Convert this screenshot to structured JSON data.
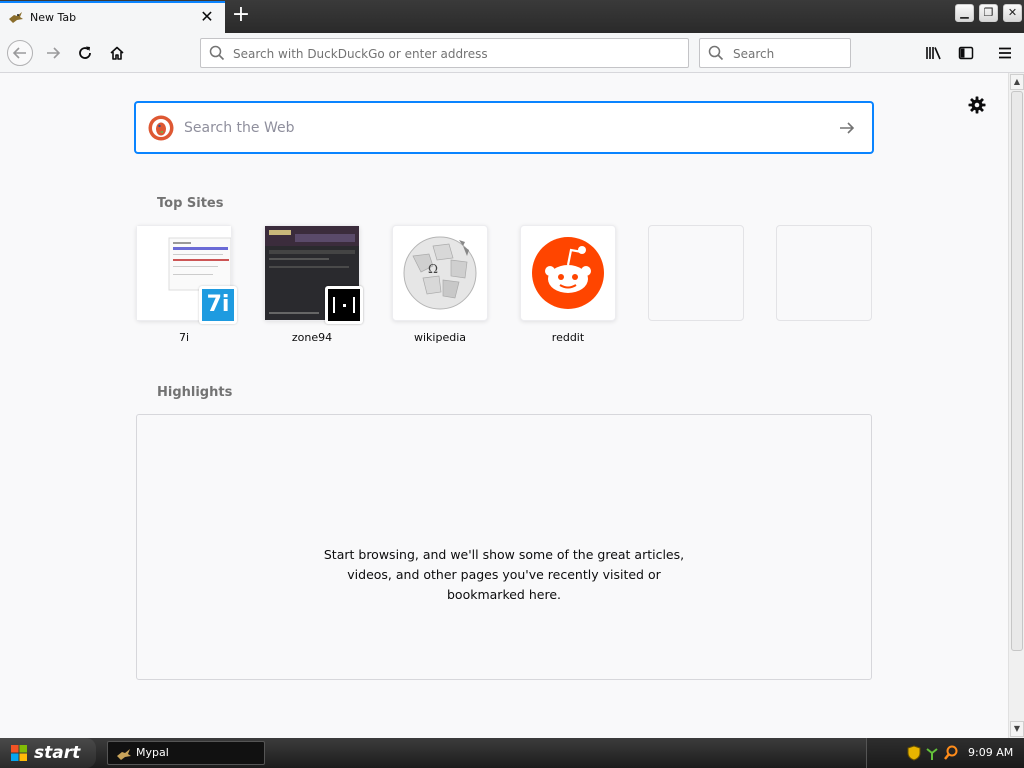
{
  "tab": {
    "title": "New Tab",
    "close": "✕"
  },
  "window_controls": {
    "minimize": "▁",
    "restore": "❐",
    "close": "✕"
  },
  "newtab": "+",
  "urlbar": {
    "placeholder": "Search with DuckDuckGo or enter address"
  },
  "searchbar": {
    "placeholder": "Search"
  },
  "websearch": {
    "placeholder": "Search the Web"
  },
  "top_sites": {
    "title": "Top Sites",
    "sites": [
      {
        "label": "7i",
        "badge": "7i"
      },
      {
        "label": "zone94"
      },
      {
        "label": "wikipedia",
        "glyph": "Ω"
      },
      {
        "label": "reddit"
      },
      {
        "label": ""
      },
      {
        "label": ""
      }
    ]
  },
  "highlights": {
    "title": "Highlights",
    "empty_line1": "Start browsing, and we'll show some of the great articles,",
    "empty_line2": "videos, and other pages you've recently visited or",
    "empty_line3": "bookmarked here."
  },
  "taskbar": {
    "start": "start",
    "task": "Mypal",
    "clock": "9:09 AM"
  },
  "colors": {
    "accent": "#0a84ff",
    "reddit": "#ff4500",
    "ddg": "#de5833",
    "seven_i": "#1e9be0"
  }
}
